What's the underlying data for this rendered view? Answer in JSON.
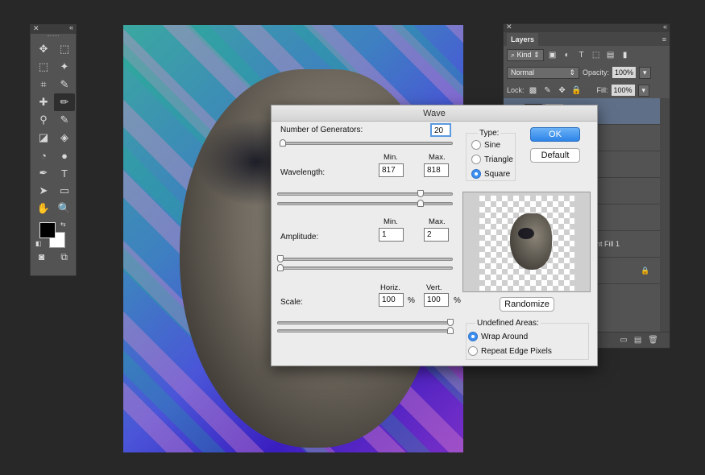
{
  "toolbar": {
    "tools": [
      "move-icon",
      "artboard-icon",
      "marquee-icon",
      "magic-wand-icon",
      "crop-icon",
      "eyedropper-icon",
      "healing-icon",
      "brush-icon",
      "stamp-icon",
      "history-brush-icon",
      "eraser-icon",
      "paint-bucket-icon",
      "blur-icon",
      "dodge-icon",
      "pen-icon",
      "type-icon",
      "path-select-icon",
      "rectangle-icon",
      "hand-icon",
      "zoom-icon"
    ],
    "glyphs": [
      "✥",
      "⬚",
      "⬚",
      "✦",
      "⌗",
      "✎",
      "✚",
      "✏",
      "⚲",
      "✎",
      "◪",
      "◈",
      "◔",
      "●",
      "✒",
      "T",
      "➤",
      "▭",
      "✋",
      "🔍"
    ],
    "foreground_color": "#000000",
    "background_color": "#ffffff"
  },
  "layers_panel": {
    "tab": "Layers",
    "filter_label": "Kind",
    "blend_mode": "Normal",
    "opacity_label": "Opacity:",
    "opacity_value": "100%",
    "lock_label": "Lock:",
    "fill_label": "Fill:",
    "fill_value": "100%",
    "layer_name_visible": "ent Fill 1"
  },
  "dialog": {
    "title": "Wave",
    "number_of_generators_label": "Number of Generators:",
    "number_of_generators": "20",
    "wavelength_label": "Wavelength:",
    "wavelength_min_label": "Min.",
    "wavelength_max_label": "Max.",
    "wavelength_min": "817",
    "wavelength_max": "818",
    "amplitude_label": "Amplitude:",
    "amplitude_min_label": "Min.",
    "amplitude_max_label": "Max.",
    "amplitude_min": "1",
    "amplitude_max": "2",
    "scale_label": "Scale:",
    "scale_horiz_label": "Horiz.",
    "scale_vert_label": "Vert.",
    "scale_horiz": "100",
    "scale_vert": "100",
    "percent": "%",
    "type_label": "Type:",
    "type_options": [
      "Sine",
      "Triangle",
      "Square"
    ],
    "type_selected": "Square",
    "ok_label": "OK",
    "default_label": "Default",
    "randomize_label": "Randomize",
    "undefined_areas_label": "Undefined Areas:",
    "undefined_options": [
      "Wrap Around",
      "Repeat Edge Pixels"
    ],
    "undefined_selected": "Wrap Around",
    "accent_color": "#3d8ff0"
  }
}
